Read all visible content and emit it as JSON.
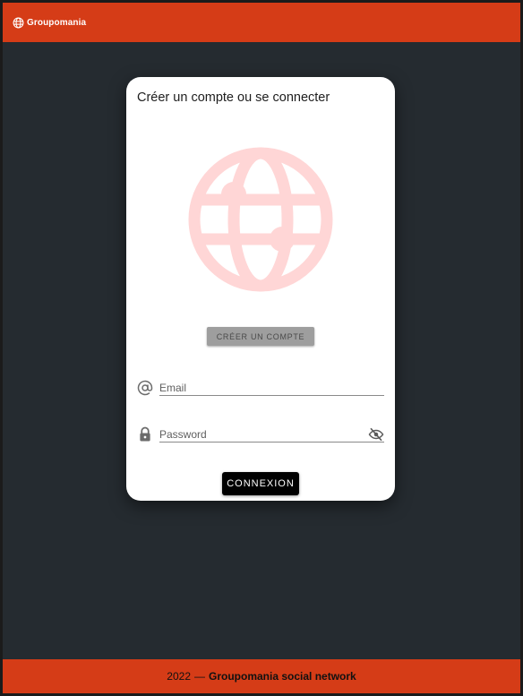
{
  "app_bar": {
    "brand_name": "Groupomania",
    "brand_icon": "globe-icon"
  },
  "card": {
    "title": "Créer un compte ou se connecter",
    "hero_icon": "globe-icon",
    "signup_button": "CRÉER UN COMPTE",
    "email": {
      "icon": "at-sign-icon",
      "placeholder": "Email",
      "value": ""
    },
    "password": {
      "icon": "lock-icon",
      "placeholder": "Password",
      "value": "",
      "toggle_icon": "eye-off-icon"
    },
    "login_button": "CONNEXION"
  },
  "footer": {
    "year": "2022",
    "separator": "—",
    "name": "Groupomania social network"
  },
  "colors": {
    "brand": "#d53c17",
    "background": "#252b30",
    "card": "#ffffff",
    "hero_icon": "#ffd6d6",
    "signup_button": "#9e9e9e",
    "login_button": "#000000"
  }
}
